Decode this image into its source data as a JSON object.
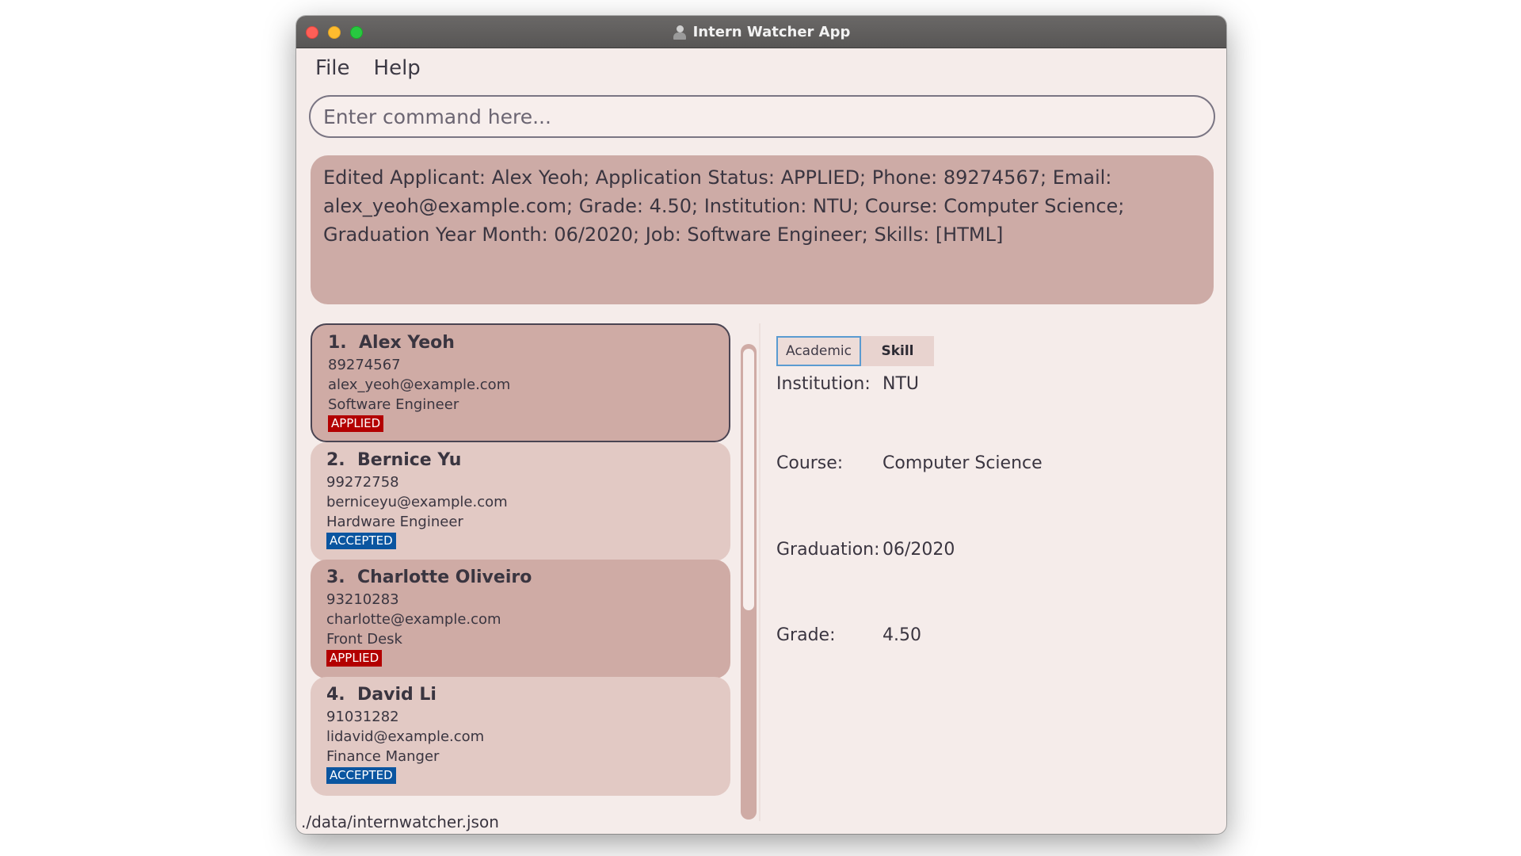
{
  "window": {
    "title": "Intern Watcher App"
  },
  "menu": [
    {
      "label": "File"
    },
    {
      "label": "Help"
    }
  ],
  "command": {
    "placeholder": "Enter command here..."
  },
  "result": {
    "text": "Edited Applicant: Alex Yeoh; Application Status: APPLIED; Phone: 89274567; Email: alex_yeoh@example.com; Grade: 4.50; Institution: NTU; Course: Computer Science; Graduation Year Month: 06/2020; Job: Software Engineer; Skills: [HTML]"
  },
  "applicants": [
    {
      "index": "1.",
      "name": "Alex Yeoh",
      "phone": "89274567",
      "email": "alex_yeoh@example.com",
      "job": "Software Engineer",
      "status": "APPLIED",
      "status_color": "#b30000",
      "selected": true
    },
    {
      "index": "2.",
      "name": "Bernice Yu",
      "phone": "99272758",
      "email": "berniceyu@example.com",
      "job": "Hardware Engineer",
      "status": "ACCEPTED",
      "status_color": "#0a55a0",
      "selected": false
    },
    {
      "index": "3.",
      "name": "Charlotte Oliveiro",
      "phone": "93210283",
      "email": "charlotte@example.com",
      "job": "Front Desk",
      "status": "APPLIED",
      "status_color": "#b30000",
      "selected": false
    },
    {
      "index": "4.",
      "name": "David Li",
      "phone": "91031282",
      "email": "lidavid@example.com",
      "job": "Finance Manger",
      "status": "ACCEPTED",
      "status_color": "#0a55a0",
      "selected": false
    }
  ],
  "tabs": [
    {
      "label": "Academic",
      "active": true
    },
    {
      "label": "Skill",
      "active": false
    }
  ],
  "details": {
    "institution": {
      "label": "Institution:",
      "value": "NTU"
    },
    "course": {
      "label": "Course:",
      "value": "Computer Science"
    },
    "graduation": {
      "label": "Graduation:",
      "value": "06/2020"
    },
    "grade": {
      "label": "Grade:",
      "value": "4.50"
    }
  },
  "status_bar": {
    "path": "./data/internwatcher.json"
  },
  "colors": {
    "window_bg": "#f5ecea",
    "result_bg": "#cdaba6",
    "card_odd": "#cfaba5",
    "card_even": "#e2c9c4",
    "applied": "#b30000",
    "accepted": "#0a55a0",
    "tab_active_border": "#5a9bd1"
  }
}
